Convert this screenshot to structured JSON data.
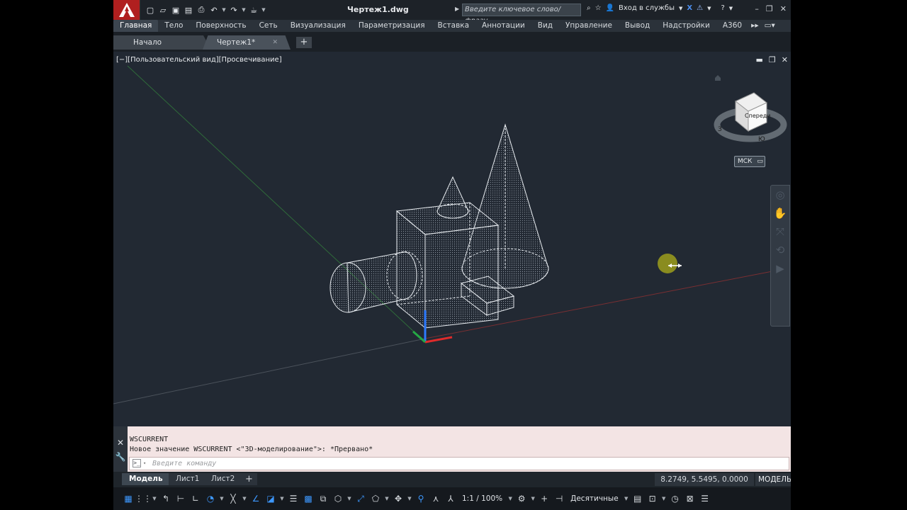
{
  "app": {
    "doc_title": "Чертеж1.dwg",
    "search_placeholder": "Введите ключевое слово/фразу",
    "signin_label": "Вход в службы"
  },
  "ribbon": {
    "tabs": [
      "Главная",
      "Тело",
      "Поверхность",
      "Сеть",
      "Визуализация",
      "Параметризация",
      "Вставка",
      "Аннотации",
      "Вид",
      "Управление",
      "Вывод",
      "Надстройки",
      "A360"
    ]
  },
  "file_tabs": {
    "start": "Начало",
    "drawing": "Чертеж1*",
    "close_glyph": "✕",
    "add_glyph": "+"
  },
  "viewport": {
    "label": "[−][Пользовательский вид][Просвечивание]",
    "viewcube_face": "Спереди",
    "compass_w": "З",
    "compass_s": "Ю",
    "ucs_label": "МСК"
  },
  "command": {
    "lines": [
      "WSCURRENT",
      "Новое значение WSCURRENT <\"3D-моделирование\">: *Прервано*"
    ],
    "input_placeholder": "Введите команду",
    "prompt_glyph": ">_"
  },
  "layout_tabs": [
    "Модель",
    "Лист1",
    "Лист2"
  ],
  "status": {
    "coords": "8.2749, 5.5495, 0.0000",
    "space": "МОДЕЛЬ",
    "scale": "1:1 / 100%",
    "units": "Десятичные"
  },
  "colors": {
    "accent": "#3d98ff",
    "app_red": "#b01f1f",
    "viewport_bg": "#222933",
    "command_bg": "#f3e4e4"
  }
}
